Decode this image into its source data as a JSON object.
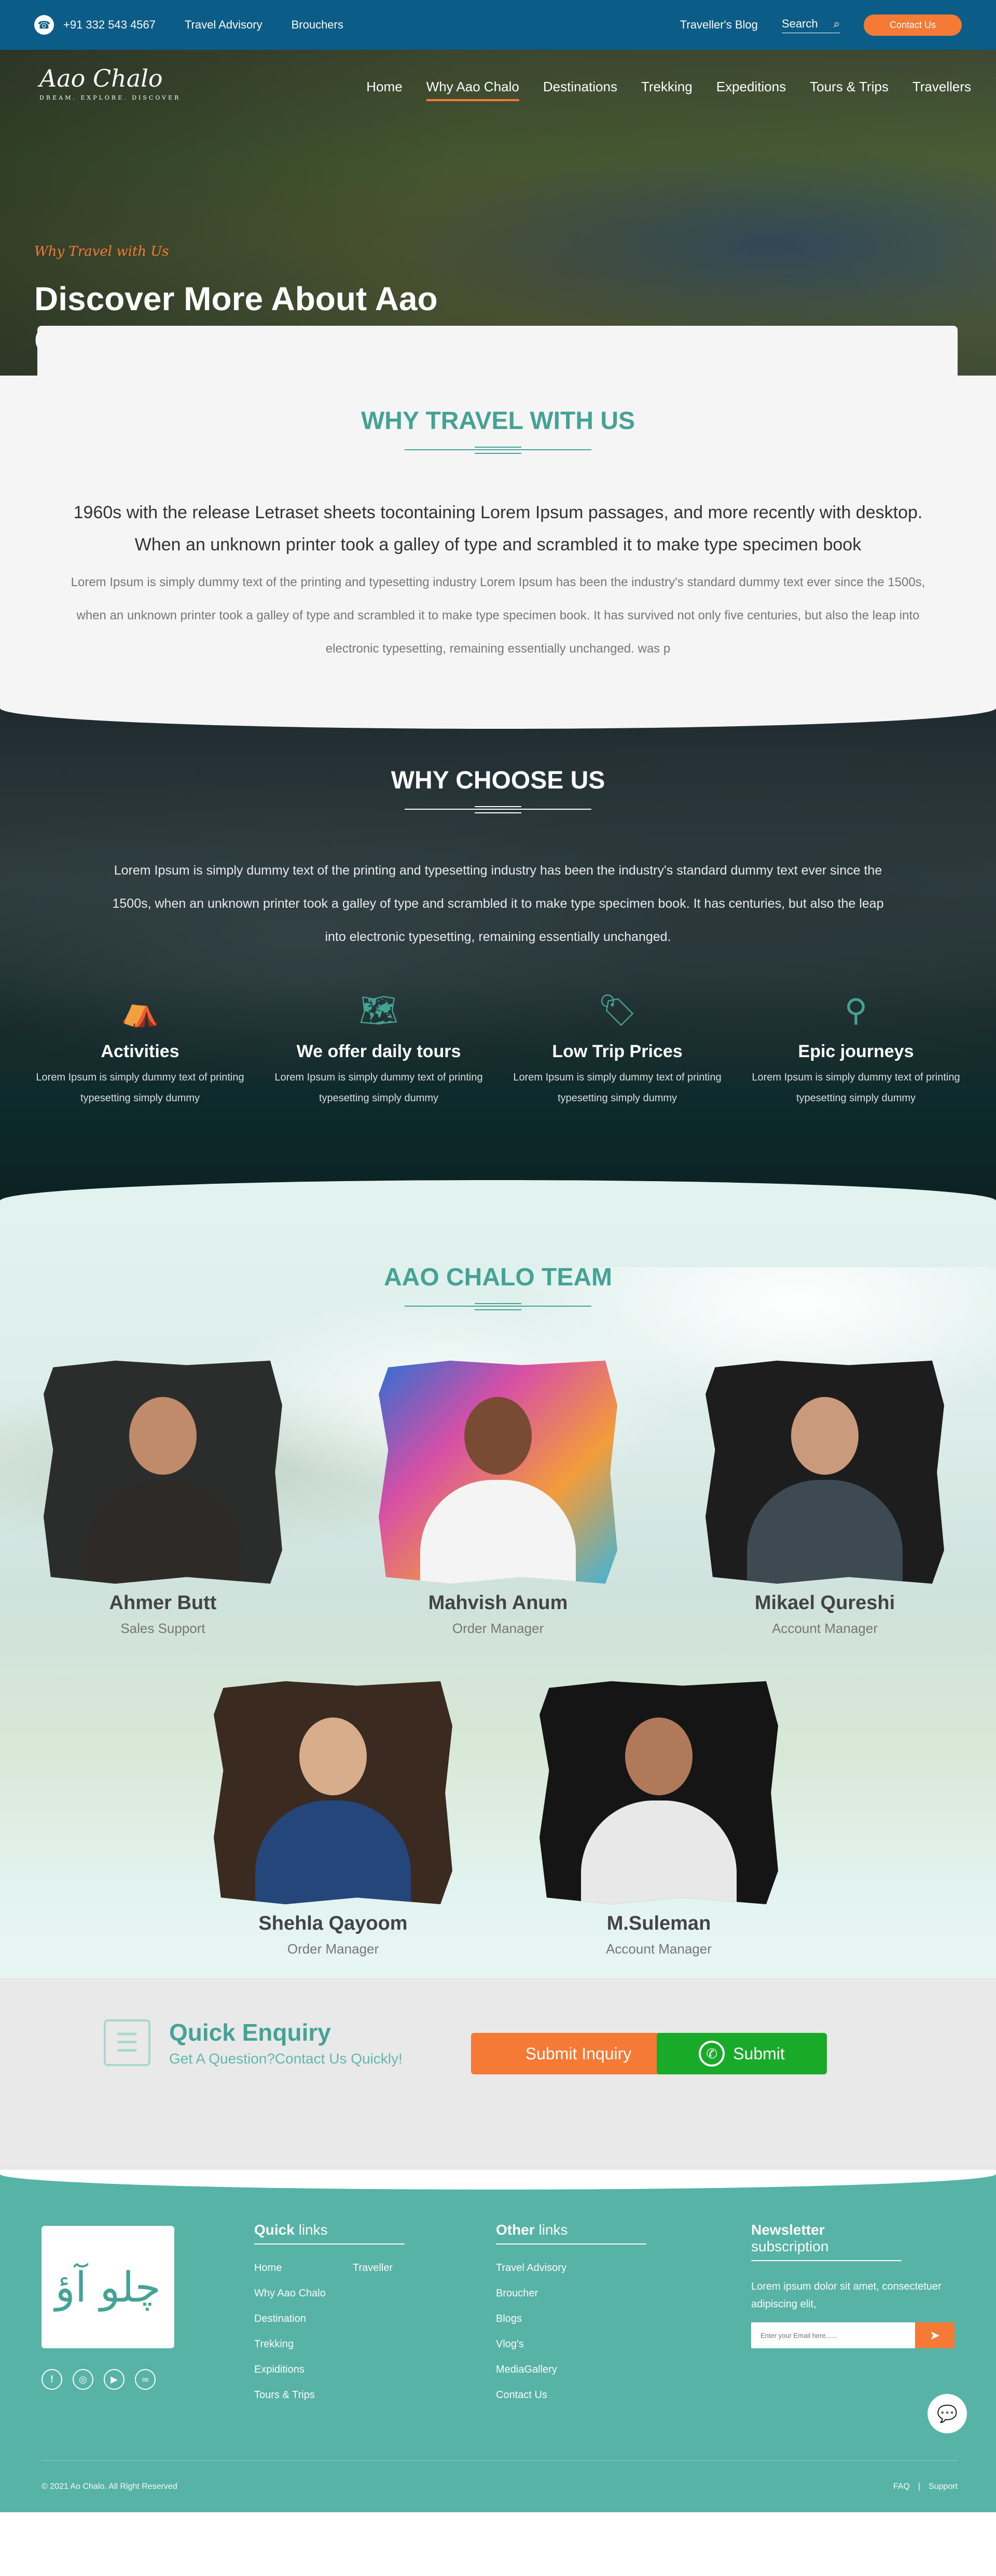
{
  "topbar": {
    "phone": "+91 332 543 4567",
    "travel_advisory": "Travel Advisory",
    "brouchers": "Brouchers",
    "blog": "Traveller's Blog",
    "search": "Search",
    "contact": "Contact Us"
  },
  "hero": {
    "logo": "Aao Chalo",
    "logo_tag": "DREAM. EXPLORE. DISCOVER",
    "nav": [
      "Home",
      "Why Aao Chalo",
      "Destinations",
      "Trekking",
      "Expeditions",
      "Tours & Trips",
      "Travellers"
    ],
    "eyebrow": "Why Travel with Us",
    "title": "Discover More About Aao Chalo"
  },
  "why_travel": {
    "title": "WHY TRAVEL WITH US",
    "lead": "1960s with the release Letraset sheets tocontaining Lorem Ipsum passages, and more recently with desktop. When an unknown printer took a galley of type and scrambled it to make type specimen book",
    "body": "Lorem Ipsum is simply dummy text of the printing and typesetting industry Lorem Ipsum has been the industry's standard dummy text ever since the 1500s, when an unknown printer took a galley of type and scrambled it to make type specimen book. It has survived not only five centuries, but also the leap into electronic typesetting, remaining essentially unchanged. was p"
  },
  "why_choose": {
    "title": "WHY CHOOSE US",
    "body": "Lorem Ipsum is simply dummy text of the printing and typesetting industry has been the industry's standard dummy text ever since the 1500s, when an unknown printer took a galley of type and scrambled it to make type specimen book. It has centuries, but also the leap into electronic typesetting, remaining essentially unchanged.",
    "features": [
      {
        "name": "Activities",
        "desc": "Lorem Ipsum is simply dummy text of printing typesetting simply dummy",
        "icon": "tent-icon"
      },
      {
        "name": "We offer daily tours",
        "desc": "Lorem Ipsum is simply dummy text of printing typesetting simply dummy",
        "icon": "map-icon"
      },
      {
        "name": "Low Trip Prices",
        "desc": "Lorem Ipsum is simply dummy text of printing typesetting simply dummy",
        "icon": "price-tag-icon"
      },
      {
        "name": "Epic journeys",
        "desc": "Lorem Ipsum is simply dummy text of printing typesetting simply dummy",
        "icon": "route-icon"
      }
    ]
  },
  "team": {
    "title": "AAO CHALO TEAM",
    "members": [
      {
        "name": "Ahmer Butt",
        "role": "Sales Support"
      },
      {
        "name": "Mahvish Anum",
        "role": "Order Manager"
      },
      {
        "name": "Mikael Qureshi",
        "role": "Account Manager"
      },
      {
        "name": "Shehla Qayoom",
        "role": "Order Manager"
      },
      {
        "name": "M.Suleman",
        "role": "Account Manager"
      }
    ]
  },
  "enquiry": {
    "title": "Quick Enquiry",
    "subtitle": "Get A Question?Contact Us Quickly!",
    "submit_inquiry": "Submit Inquiry",
    "submit": "Submit"
  },
  "footer": {
    "logo_text": "چلو آؤ",
    "quick": {
      "bold": "Quick",
      "light": " links",
      "links": [
        "Home",
        "Traveller",
        "Why Aao Chalo",
        "",
        "Destination",
        "",
        "Trekking",
        "",
        "Expiditions",
        "",
        "Tours & Trips",
        ""
      ]
    },
    "other": {
      "bold": "Other",
      "light": " links",
      "links": [
        "Travel Advisory",
        "Broucher",
        "Blogs",
        "Vlog's",
        "MediaGallery",
        "Contact Us"
      ]
    },
    "newsletter": {
      "bold": "Newsletter",
      "light": " subscription",
      "text": "Lorem ipsum dolor sit amet, consectetuer adipiscing elit,",
      "placeholder": "Enter your Email here......"
    },
    "copyright": "© 2021 Ao Chalo. All Right Reserved",
    "faq": "FAQ",
    "separator": "|",
    "support": "Support"
  },
  "colors": {
    "primary": "#45a396",
    "accent": "#f47a36",
    "topbar": "#0b5c86",
    "whatsapp": "#1aaa2a"
  }
}
